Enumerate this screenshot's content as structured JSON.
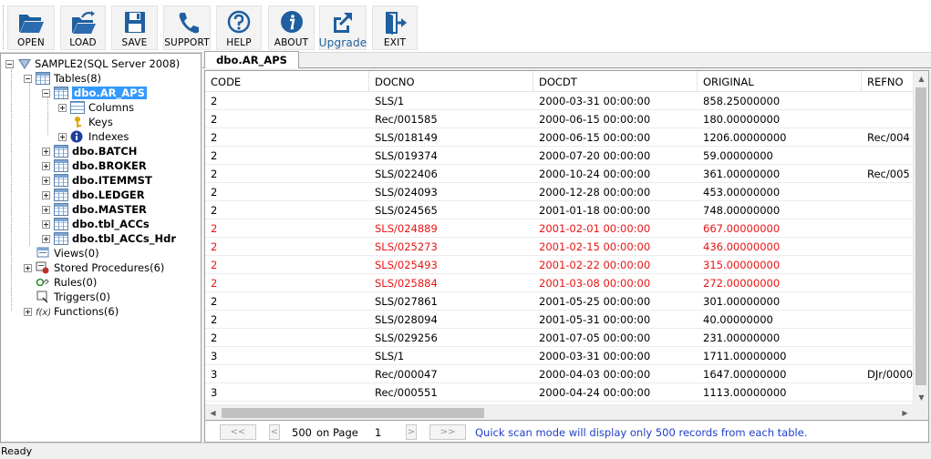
{
  "toolbar": {
    "buttons": [
      {
        "label": "OPEN",
        "icon": "folder-open-icon"
      },
      {
        "label": "LOAD",
        "icon": "folder-load-icon"
      },
      {
        "label": "SAVE",
        "icon": "floppy-disk-icon"
      },
      {
        "label": "SUPPORT",
        "icon": "phone-icon"
      },
      {
        "label": "HELP",
        "icon": "question-circle-icon"
      },
      {
        "label": "ABOUT",
        "icon": "info-circle-icon"
      },
      {
        "label": "Upgrade",
        "icon": "external-link-icon"
      },
      {
        "label": "EXIT",
        "icon": "exit-door-icon"
      }
    ]
  },
  "tree": {
    "root": "SAMPLE2(SQL Server 2008)",
    "tables": "Tables(8)",
    "selected_table": "dbo.AR_APS",
    "table_children": [
      "Columns",
      "Keys",
      "Indexes"
    ],
    "other_tables": [
      "dbo.BATCH",
      "dbo.BROKER",
      "dbo.ITEMMST",
      "dbo.LEDGER",
      "dbo.MASTER",
      "dbo.tbl_ACCs",
      "dbo.tbl_ACCs_Hdr"
    ],
    "views": "Views(0)",
    "stored_procedures": "Stored Procedures(6)",
    "rules": "Rules(0)",
    "triggers": "Triggers(0)",
    "functions": "Functions(6)"
  },
  "tab": {
    "label": "dbo.AR_APS"
  },
  "grid": {
    "columns": [
      "CODE",
      "DOCNO",
      "DOCDT",
      "ORIGINAL",
      "REFNO"
    ],
    "rows": [
      {
        "c": [
          "2",
          "SLS/1",
          "2000-03-31 00:00:00",
          "858.25000000",
          ""
        ],
        "red": false
      },
      {
        "c": [
          "2",
          "Rec/001585",
          "2000-06-15 00:00:00",
          "180.00000000",
          ""
        ],
        "red": false
      },
      {
        "c": [
          "2",
          "SLS/018149",
          "2000-06-15 00:00:00",
          "1206.00000000",
          "Rec/004"
        ],
        "red": false
      },
      {
        "c": [
          "2",
          "SLS/019374",
          "2000-07-20 00:00:00",
          "59.00000000",
          ""
        ],
        "red": false
      },
      {
        "c": [
          "2",
          "SLS/022406",
          "2000-10-24 00:00:00",
          "361.00000000",
          "Rec/005"
        ],
        "red": false
      },
      {
        "c": [
          "2",
          "SLS/024093",
          "2000-12-28 00:00:00",
          "453.00000000",
          ""
        ],
        "red": false
      },
      {
        "c": [
          "2",
          "SLS/024565",
          "2001-01-18 00:00:00",
          "748.00000000",
          ""
        ],
        "red": false
      },
      {
        "c": [
          "2",
          "SLS/024889",
          "2001-02-01  00:00:00",
          "667.00000000",
          ""
        ],
        "red": true
      },
      {
        "c": [
          "2",
          "SLS/025273",
          "2001-02-15  00:00:00",
          "436.00000000",
          ""
        ],
        "red": true
      },
      {
        "c": [
          "2",
          "SLS/025493",
          "2001-02-22  00:00:00",
          "315.00000000",
          ""
        ],
        "red": true
      },
      {
        "c": [
          "2",
          "SLS/025884",
          "2001-03-08  00:00:00",
          "272.00000000",
          ""
        ],
        "red": true
      },
      {
        "c": [
          "2",
          "SLS/027861",
          "2001-05-25 00:00:00",
          "301.00000000",
          ""
        ],
        "red": false
      },
      {
        "c": [
          "2",
          "SLS/028094",
          "2001-05-31 00:00:00",
          "40.00000000",
          ""
        ],
        "red": false
      },
      {
        "c": [
          "2",
          "SLS/029256",
          "2001-07-05 00:00:00",
          "231.00000000",
          ""
        ],
        "red": false
      },
      {
        "c": [
          "3",
          "SLS/1",
          "2000-03-31 00:00:00",
          "1711.00000000",
          ""
        ],
        "red": false
      },
      {
        "c": [
          "3",
          "Rec/000047",
          "2000-04-03 00:00:00",
          "1647.00000000",
          "DJr/0000"
        ],
        "red": false
      },
      {
        "c": [
          "3",
          "Rec/000551",
          "2000-04-24 00:00:00",
          "1113.00000000",
          ""
        ],
        "red": false
      }
    ]
  },
  "pager": {
    "first": "<<",
    "prev": "<",
    "page_size": "500",
    "on_page_label": "on Page",
    "page": "1",
    "next": ">",
    "last": ">>",
    "message": "Quick scan mode will display only 500 records  from each table."
  },
  "status": {
    "text": "Ready"
  },
  "colors": {
    "selection": "#3399ff",
    "highlight_row_text": "#e81414",
    "info_text": "#1f3fc9",
    "icon_blue": "#1f5f9f"
  }
}
